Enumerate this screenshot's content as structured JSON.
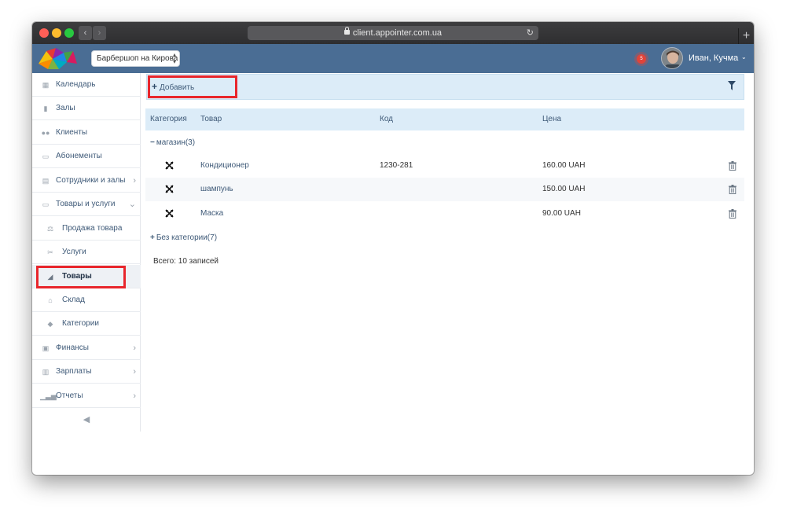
{
  "browser": {
    "url": "client.appointer.com.ua"
  },
  "header": {
    "branch": "Барбершоп на Кирова",
    "notification_count": "5",
    "user_name": "Иван, Кучма"
  },
  "sidebar": {
    "items": [
      {
        "label": "Календарь",
        "icon": "calendar-icon"
      },
      {
        "label": "Залы",
        "icon": "bookmark-icon"
      },
      {
        "label": "Клиенты",
        "icon": "users-icon"
      },
      {
        "label": "Абонементы",
        "icon": "card-icon"
      },
      {
        "label": "Сотрудники и залы",
        "icon": "id-card-icon"
      },
      {
        "label": "Товары и услуги",
        "icon": "card-icon"
      },
      {
        "label": "Продажа товара",
        "icon": "scales-icon"
      },
      {
        "label": "Услуги",
        "icon": "scissors-icon"
      },
      {
        "label": "Товары",
        "icon": "tag-icon"
      },
      {
        "label": "Склад",
        "icon": "bank-icon"
      },
      {
        "label": "Категории",
        "icon": "tags-icon"
      },
      {
        "label": "Финансы",
        "icon": "money-icon"
      },
      {
        "label": "Зарплаты",
        "icon": "calculator-icon"
      },
      {
        "label": "Отчеты",
        "icon": "bar-chart-icon"
      }
    ]
  },
  "toolbar": {
    "add_label": "Добавить"
  },
  "table": {
    "columns": [
      "Категория",
      "Товар",
      "Код",
      "Цена"
    ],
    "group_open": "магазин(3)",
    "rows": [
      {
        "name": "Кондиционер",
        "code": "1230-281",
        "price": "160.00 UAH"
      },
      {
        "name": "шампунь",
        "code": "",
        "price": "150.00 UAH"
      },
      {
        "name": "Маска",
        "code": "",
        "price": "90.00 UAH"
      }
    ],
    "group_closed": "Без категории(7)",
    "total": "Всего: 10 записей"
  },
  "colors": {
    "header": "#4a6d94",
    "accent_light": "#dcecf8",
    "highlight": "#e8262c"
  }
}
